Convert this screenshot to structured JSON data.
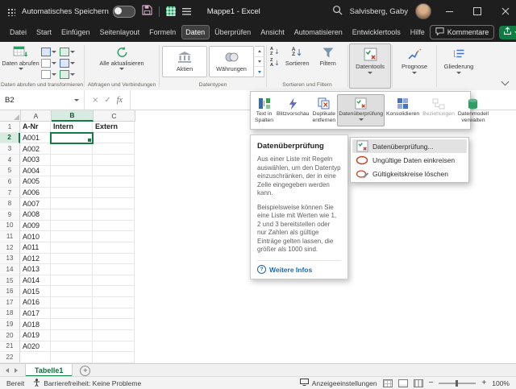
{
  "colors": {
    "accent_green": "#107c41",
    "titlebar_bg": "#1e1e1e",
    "link_blue": "#0f6cbd",
    "invalid_red": "#c43e1c"
  },
  "titlebar": {
    "autosave_label": "Automatisches Speichern",
    "autosave_state": "off",
    "doc_title": "Mappe1 - Excel",
    "user_name": "Salvisberg, Gaby"
  },
  "ribbon_tabs": {
    "items": [
      "Datei",
      "Start",
      "Einfügen",
      "Seitenlayout",
      "Formeln",
      "Daten",
      "Überprüfen",
      "Ansicht",
      "Automatisieren",
      "Entwicklertools",
      "Hilfe"
    ],
    "active": "Daten",
    "comments_label": "Kommentare"
  },
  "ribbon": {
    "get_data": "Daten abrufen",
    "group_get_transform": "Daten abrufen und transformieren",
    "refresh_all": "Alle aktualisieren",
    "group_queries": "Abfragen und Verbindungen",
    "stocks": "Aktien",
    "currencies": "Währungen",
    "group_datatypes": "Datentypen",
    "sort": "Sortieren",
    "filter": "Filtern",
    "group_sort_filter": "Sortieren und Filtern",
    "datatools": "Datentools",
    "forecast": "Prognose",
    "outline": "Gliederung"
  },
  "formula_bar": {
    "name_box": "B2",
    "fx": "fx",
    "cancel": "×",
    "enter": "✓",
    "formula_value": ""
  },
  "datatools_flyout": {
    "items": [
      {
        "label": "Text in Spalten",
        "icon": "text-to-columns",
        "active": false,
        "enabled": true,
        "has_dropdown": false
      },
      {
        "label": "Blitzvorschau",
        "icon": "flash-fill",
        "active": false,
        "enabled": true,
        "has_dropdown": false
      },
      {
        "label": "Duplikate entfernen",
        "icon": "remove-duplicates",
        "active": false,
        "enabled": true,
        "has_dropdown": false
      },
      {
        "label": "Datenüberprüfung",
        "icon": "data-validation",
        "active": true,
        "enabled": true,
        "has_dropdown": true
      },
      {
        "label": "Konsolidieren",
        "icon": "consolidate",
        "active": false,
        "enabled": true,
        "has_dropdown": false
      },
      {
        "label": "Beziehungen",
        "icon": "relationships",
        "active": false,
        "enabled": false,
        "has_dropdown": false
      },
      {
        "label": "Datenmodell verwalten",
        "icon": "data-model",
        "active": false,
        "enabled": true,
        "has_dropdown": false
      }
    ]
  },
  "validation_menu": {
    "items": [
      {
        "label": "Datenüberprüfung...",
        "icon": "data-validation",
        "active": true
      },
      {
        "label": "Ungültige Daten einkreisen",
        "icon": "circle-invalid",
        "active": false
      },
      {
        "label": "Gültigkeitskreise löschen",
        "icon": "clear-circles",
        "active": false
      }
    ]
  },
  "tooltip": {
    "title": "Datenüberprüfung",
    "paragraphs": [
      "Aus einer Liste mit Regeln auswählen, um den Datentyp einzuschränken, der in eine Zelle eingegeben werden kann.",
      "Beispielsweise können Sie eine Liste mit Werten wie 1, 2 und 3 bereitstellen oder nur Zahlen als gültige Einträge gelten lassen, die größer als 1000 sind."
    ],
    "link": "Weitere Infos"
  },
  "sheet": {
    "visible_columns": [
      "A",
      "B",
      "C"
    ],
    "header_values": [
      "A-Nr",
      "Intern",
      "Extern"
    ],
    "a_column_values": [
      "A001",
      "A002",
      "A003",
      "A004",
      "A005",
      "A006",
      "A007",
      "A008",
      "A009",
      "A010",
      "A011",
      "A012",
      "A013",
      "A014",
      "A015",
      "A016",
      "A017",
      "A018",
      "A019",
      "A020"
    ],
    "visible_rows": 22,
    "selected_cell": "B2"
  },
  "sheet_tabs": {
    "active": "Tabelle1",
    "tabs": [
      "Tabelle1"
    ]
  },
  "status_bar": {
    "mode": "Bereit",
    "accessibility": "Barrierefreiheit: Keine Probleme",
    "display_settings": "Anzeigeeinstellungen",
    "zoom_level": "100%"
  }
}
